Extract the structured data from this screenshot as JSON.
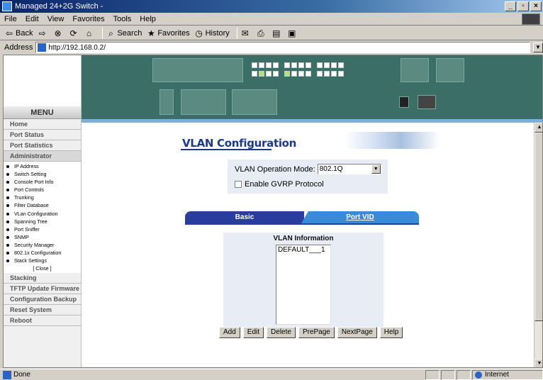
{
  "window": {
    "title": "Managed 24+2G Switch -",
    "min": "_",
    "max": "▫",
    "close": "×"
  },
  "menubar": [
    "File",
    "Edit",
    "View",
    "Favorites",
    "Tools",
    "Help"
  ],
  "toolbar": {
    "back": "Back",
    "search": "Search",
    "favorites": "Favorites",
    "history": "History"
  },
  "address": {
    "label": "Address",
    "url": "http://192.168.0.2/"
  },
  "left_menu": {
    "title": "MENU",
    "items": [
      "Home",
      "Port Status",
      "Port Statistics",
      "Administrator"
    ],
    "admin_sub": [
      "IP Address",
      "Switch Setting",
      "Console Port Info",
      "Port Controls",
      "Trunking",
      "Filter Database",
      "VLan Configuration",
      "Spanning Tree",
      "Port Sniffer",
      "SNMP",
      "Security Manager",
      "802.1x Configuration",
      "Stack Settings"
    ],
    "close": "[ Close ]",
    "bottom_items": [
      "Stacking",
      "TFTP Update Firmware",
      "Configuration Backup",
      "Reset System",
      "Reboot"
    ]
  },
  "page": {
    "title": "VLAN Configuration",
    "op_mode_label": "VLAN Operation Mode:",
    "op_mode_value": "802.1Q",
    "gvrp_label": "Enable GVRP Protocol",
    "tab_basic": "Basic",
    "tab_pvid": "Port VID",
    "info_title": "VLAN Information",
    "vlan_list": [
      "DEFAULT___1"
    ],
    "buttons": [
      "Add",
      "Edit",
      "Delete",
      "PrePage",
      "NextPage",
      "Help"
    ]
  },
  "status": {
    "text": "Done",
    "zone": "Internet"
  }
}
